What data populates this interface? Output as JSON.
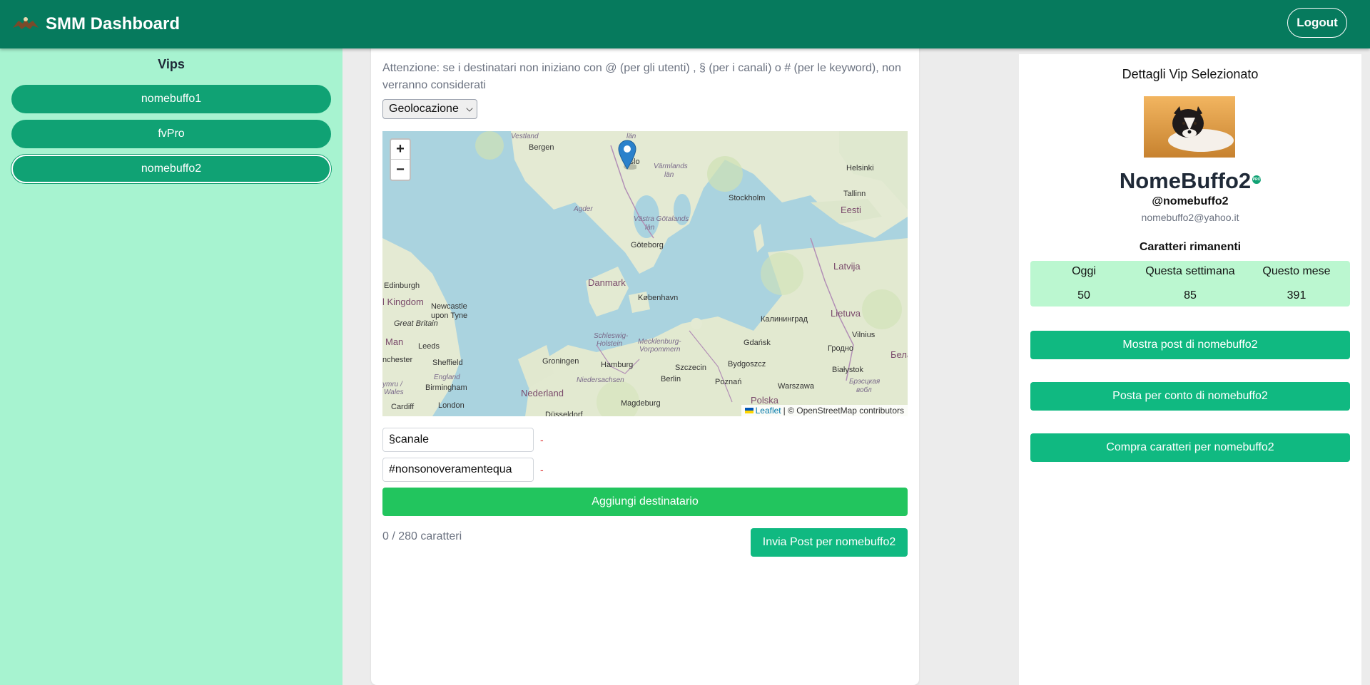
{
  "header": {
    "title": "SMM Dashboard",
    "logout_label": "Logout"
  },
  "sidebar": {
    "title": "Vips",
    "items": [
      {
        "label": "nomebuffo1"
      },
      {
        "label": "fvPro"
      },
      {
        "label": "nomebuffo2"
      }
    ],
    "selected": "nomebuffo2"
  },
  "main": {
    "warning": "Attenzione: se i destinatari non iniziano con @ (per gli utenti) , § (per i canali) o # (per le keyword), non verranno considerati",
    "recipient_type": "Geolocazione",
    "map": {
      "zoom_in": "+",
      "zoom_out": "−",
      "attribution_leaflet": "Leaflet",
      "attribution_rest": "| © OpenStreetMap contributors",
      "labels": {
        "vestland": "Vestland",
        "bergen": "Bergen",
        "oslo": "Oslo",
        "varmlands": "Värmlands",
        "lan1": "län",
        "lan_top": "län",
        "helsinki": "Helsinki",
        "tallinn": "Tallinn",
        "eesti": "Eesti",
        "stockholm": "Stockholm",
        "agder": "Agder",
        "vastra": "Västra Götalands",
        "lan2": "län",
        "goteborg": "Göteborg",
        "latvija": "Latvija",
        "danmark": "Danmark",
        "edinburgh": "Edinburgh",
        "kingdom": "l Kingdom",
        "newcastle": "Newcastle",
        "upontyne": "upon Tyne",
        "greatbritain": "Great Britain",
        "man": "Man",
        "leeds": "Leeds",
        "kobenhavn": "København",
        "lietuva": "Lietuva",
        "kaliningrad": "Калининград",
        "vilnius": "Vilnius",
        "gdansk": "Gdańsk",
        "grodno": "Гродно",
        "bela": "Бела",
        "schleswig": "Schleswig-",
        "holstein": "Holstein",
        "mecklenburg": "Mecklenburg-",
        "vorpommern": "Vorpommern",
        "manchester": "nchester",
        "sheffield": "Sheffield",
        "groningen": "Groningen",
        "hamburg": "Hamburg",
        "szczecin": "Szczecin",
        "bydgoszcz": "Bydgoszcz",
        "bialystok": "Białystok",
        "england": "England",
        "birmingham": "Birmingham",
        "niedersachsen": "Niedersachsen",
        "berlin": "Berlin",
        "poznan": "Poznań",
        "warszawa": "Warszawa",
        "brest": "Брэсцкая",
        "vobl": "вобл",
        "cymru": "ymru /",
        "wales": "Wales",
        "nederland": "Nederland",
        "cardiff": "Cardiff",
        "london": "London",
        "magdeburg": "Magdeburg",
        "polska": "Polska",
        "dusseldorf": "Düsseldorf"
      }
    },
    "recipients": [
      {
        "value": "§canale",
        "remove": "-"
      },
      {
        "value": "#nonsonoveramentequa",
        "remove": "-"
      }
    ],
    "add_recipient_label": "Aggiungi destinatario",
    "char_count": "0 / 280 caratteri",
    "send_label": "Invia Post per nomebuffo2"
  },
  "details": {
    "title": "Dettagli Vip Selezionato",
    "name": "NomeBuffo2",
    "badge": "PRO",
    "handle": "@nomebuffo2",
    "email": "nomebuffo2@yahoo.it",
    "chars_title": "Caratteri rimanenti",
    "chars": {
      "headers": [
        "Oggi",
        "Questa settimana",
        "Questo mese"
      ],
      "values": [
        "50",
        "85",
        "391"
      ]
    },
    "buttons": {
      "show_posts": "Mostra post di nomebuffo2",
      "post_for": "Posta per conto di nomebuffo2",
      "buy_chars": "Compra caratteri per nomebuffo2"
    }
  },
  "colors": {
    "header_bg": "#067a5d",
    "sidebar_bg": "#a7f3d0",
    "vip_button": "#10a274",
    "add_button": "#22c55e",
    "primary_button": "#10b981",
    "chars_table_bg": "#bbf7d0"
  }
}
